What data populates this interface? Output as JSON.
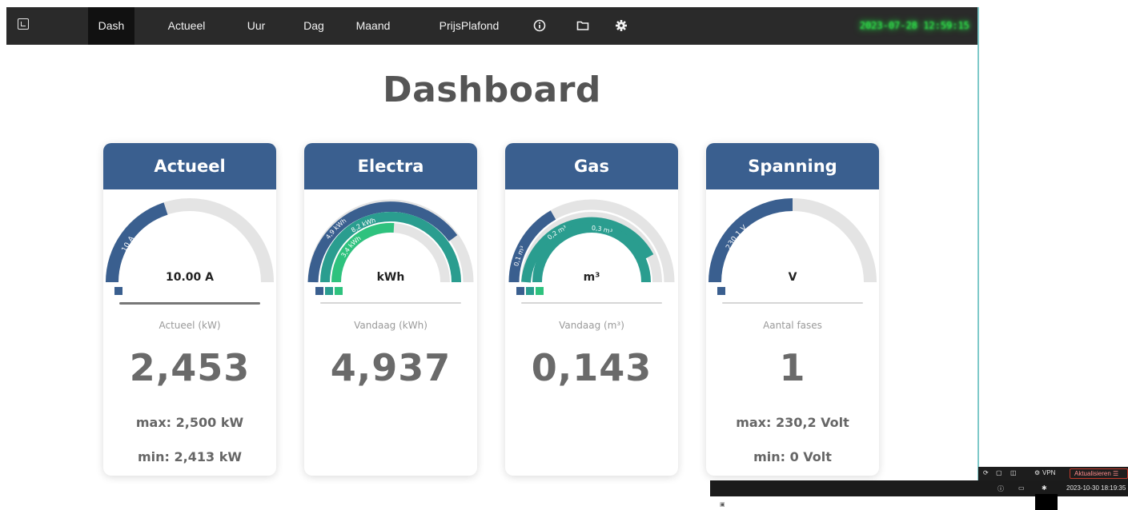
{
  "nav": {
    "items": [
      {
        "label": "Dash",
        "active": true
      },
      {
        "label": "Actueel",
        "active": false
      },
      {
        "label": "Uur",
        "active": false
      },
      {
        "label": "Dag",
        "active": false
      },
      {
        "label": "Maand",
        "active": false
      },
      {
        "label": "PrijsPlafond",
        "active": false
      }
    ],
    "icons": [
      "info-icon",
      "folder-icon",
      "gear-icon"
    ],
    "clock": "2023-07-28 12:59:15"
  },
  "page": {
    "title": "Dashboard"
  },
  "colors": {
    "header": "#3a5f8f",
    "teal": "#2a9d8f",
    "green": "#2ec27e",
    "navbar": "#2a2a2a",
    "clock": "#30ff50"
  },
  "cards": {
    "actueel": {
      "header": "Actueel",
      "gauge_arc_label": "10 A",
      "gauge_value_fraction": 0.3,
      "gauge_center": "10.00 A",
      "sublabel": "Actueel (kW)",
      "value": "2,453",
      "max": "max: 2,500 kW",
      "min": "min: 2,413 kW"
    },
    "electra": {
      "header": "Electra",
      "arc_labels": [
        "4,9 kWh",
        "8,2 kWh",
        "3,4 kWh"
      ],
      "gauge_center": "kWh",
      "sublabel": "Vandaag (kWh)",
      "value": "4,937"
    },
    "gas": {
      "header": "Gas",
      "arc_labels": [
        "0,1 m³",
        "0,2 m³",
        "0,3 m³"
      ],
      "gauge_center": "m³",
      "sublabel": "Vandaag (m³)",
      "value": "0,143"
    },
    "spanning": {
      "header": "Spanning",
      "gauge_arc_label": "230,1 V",
      "gauge_value_fraction": 0.36,
      "gauge_center": "V",
      "sublabel": "Aantal fases",
      "value": "1",
      "max": "max: 230,2 Volt",
      "min": "min: 0 Volt"
    }
  },
  "taskbar": {
    "vpn": "VPN",
    "update_button": "Aktualisieren",
    "clock": "2023-10-30 18:19:35"
  }
}
